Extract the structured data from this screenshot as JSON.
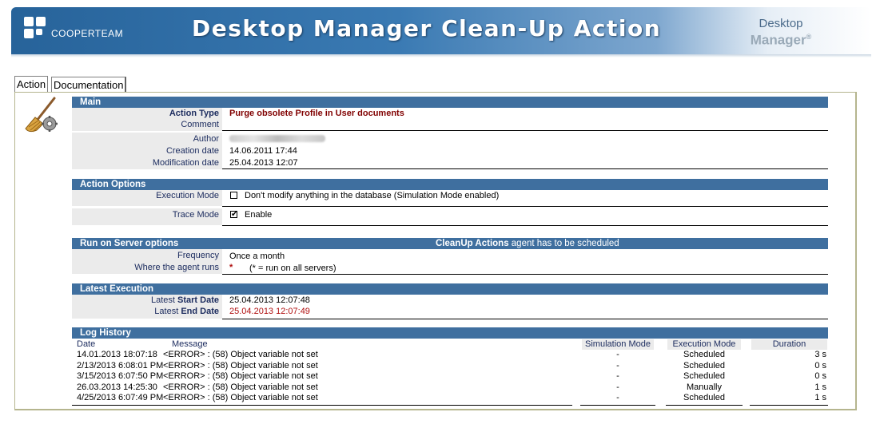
{
  "header": {
    "company": "COOPERTEAM",
    "title": "Desktop Manager Clean-Up Action",
    "product_line1": "Desktop",
    "product_line2": "Manager",
    "product_mark": "®"
  },
  "tabs": [
    {
      "label": "Action",
      "active": true
    },
    {
      "label": "Documentation",
      "active": false
    }
  ],
  "main": {
    "section_title": "Main",
    "action_type_label": "Action Type",
    "action_type_value": "Purge obsolete Profile in User documents",
    "comment_label": "Comment",
    "comment_value": "",
    "author_label": "Author",
    "creation_date_label": "Creation date",
    "creation_date_value": "14.06.2011 17:44",
    "modification_date_label": "Modification date",
    "modification_date_value": "25.04.2013 12:07"
  },
  "action_options": {
    "section_title": "Action Options",
    "execution_mode_label": "Execution Mode",
    "execution_mode_text": "Don't modify anything in the database (Simulation Mode enabled)",
    "execution_mode_checked": false,
    "trace_mode_label": "Trace Mode",
    "trace_mode_text": "Enable",
    "trace_mode_checked": true,
    "check_glyph": "✔"
  },
  "run_on_server": {
    "section_title": "Run on Server options",
    "note_bold": "CleanUp Actions",
    "note_rest": " agent has to be scheduled",
    "frequency_label": "Frequency",
    "frequency_value": "Once a month",
    "where_label": "Where the agent runs",
    "where_value": "*",
    "where_hint": "(* = run on all servers)"
  },
  "latest_execution": {
    "section_title": "Latest Execution",
    "start_label_prefix": "Latest ",
    "start_label_bold": "Start Date",
    "start_value": "25.04.2013 12:07:48",
    "end_label_prefix": "Latest ",
    "end_label_bold": "End Date",
    "end_value": "25.04.2013 12:07:49"
  },
  "log_history": {
    "section_title": "Log History",
    "columns": {
      "date": "Date",
      "message": "Message",
      "simulation_mode": "Simulation Mode",
      "execution_mode": "Execution Mode",
      "duration": "Duration"
    },
    "rows": [
      {
        "date": "14.01.2013 18:07:18",
        "message": "<ERROR> : (58) Object variable not set",
        "simulation": "-",
        "execution": "Scheduled",
        "duration": "3 s"
      },
      {
        "date": "2/13/2013 6:08:01 PM",
        "message": "<ERROR> : (58) Object variable not set",
        "simulation": "-",
        "execution": "Scheduled",
        "duration": "0 s"
      },
      {
        "date": "3/15/2013 6:07:50 PM",
        "message": "<ERROR> : (58) Object variable not set",
        "simulation": "-",
        "execution": "Scheduled",
        "duration": "0 s"
      },
      {
        "date": "26.03.2013 14:25:30",
        "message": "<ERROR> : (58) Object variable not set",
        "simulation": "-",
        "execution": "Manually",
        "duration": "1 s"
      },
      {
        "date": "4/25/2013 6:07:49 PM",
        "message": "<ERROR> : (58) Object variable not set",
        "simulation": "-",
        "execution": "Scheduled",
        "duration": "1 s"
      }
    ]
  },
  "colors": {
    "section_header": "#3f6f9f",
    "label_text": "#1b2b5e",
    "action_type_value": "#800000",
    "end_date_value": "#b01010",
    "label_background": "#ebebeb"
  },
  "icons": {
    "company_logo": "cooperteam-logo-icon",
    "action_icon": "broom-gear-icon"
  }
}
